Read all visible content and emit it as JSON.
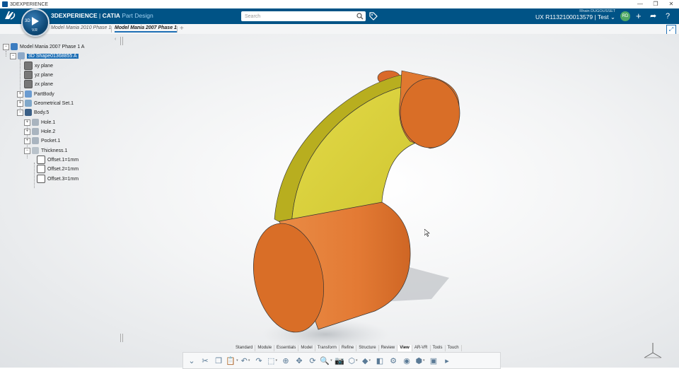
{
  "window": {
    "title": "3DEXPERIENCE",
    "controls": [
      "—",
      "❐",
      "✕"
    ]
  },
  "header": {
    "brand_main": "3DEXPERIENCE",
    "brand_sep": " | ",
    "brand_product": "CATIA",
    "brand_app": "Part Design",
    "compass_label": "3D",
    "compass_version": "V.R",
    "search_placeholder": "Search",
    "user_name": "Rhain DUGOUSSET",
    "user_role": "UX R1132100013579 | Test",
    "avatar_initials": "RD"
  },
  "tabs": [
    {
      "label": "Model Mania 2010 Phase 1",
      "active": false
    },
    {
      "label": "Model Mania 2007 Phase 1",
      "active": true
    }
  ],
  "tree": {
    "root": "Model Mania 2007 Phase 1 A",
    "shape": "3D Shape01368855 A",
    "items": [
      {
        "label": "xy plane"
      },
      {
        "label": "yz plane"
      },
      {
        "label": "zx plane"
      },
      {
        "label": "PartBody"
      },
      {
        "label": "Geometrical Set.1"
      },
      {
        "label": "Body.5"
      },
      {
        "label": "Hole.1"
      },
      {
        "label": "Hole.2"
      },
      {
        "label": "Pocket.1"
      },
      {
        "label": "Thickness.1"
      },
      {
        "label": "Offset.1=1mm"
      },
      {
        "label": "Offset.2=1mm"
      },
      {
        "label": "Offset.3=1mm"
      }
    ]
  },
  "section_tabs": [
    "Standard",
    "Module",
    "Essentials",
    "Model",
    "Transform",
    "Refine",
    "Structure",
    "Review",
    "View",
    "AR-VR",
    "Tools",
    "Touch"
  ],
  "active_section": "View",
  "colors": {
    "header_bg": "#005386",
    "accent": "#1e6fb5",
    "part_orange": "#e07830",
    "part_yellow": "#d8cf35"
  }
}
